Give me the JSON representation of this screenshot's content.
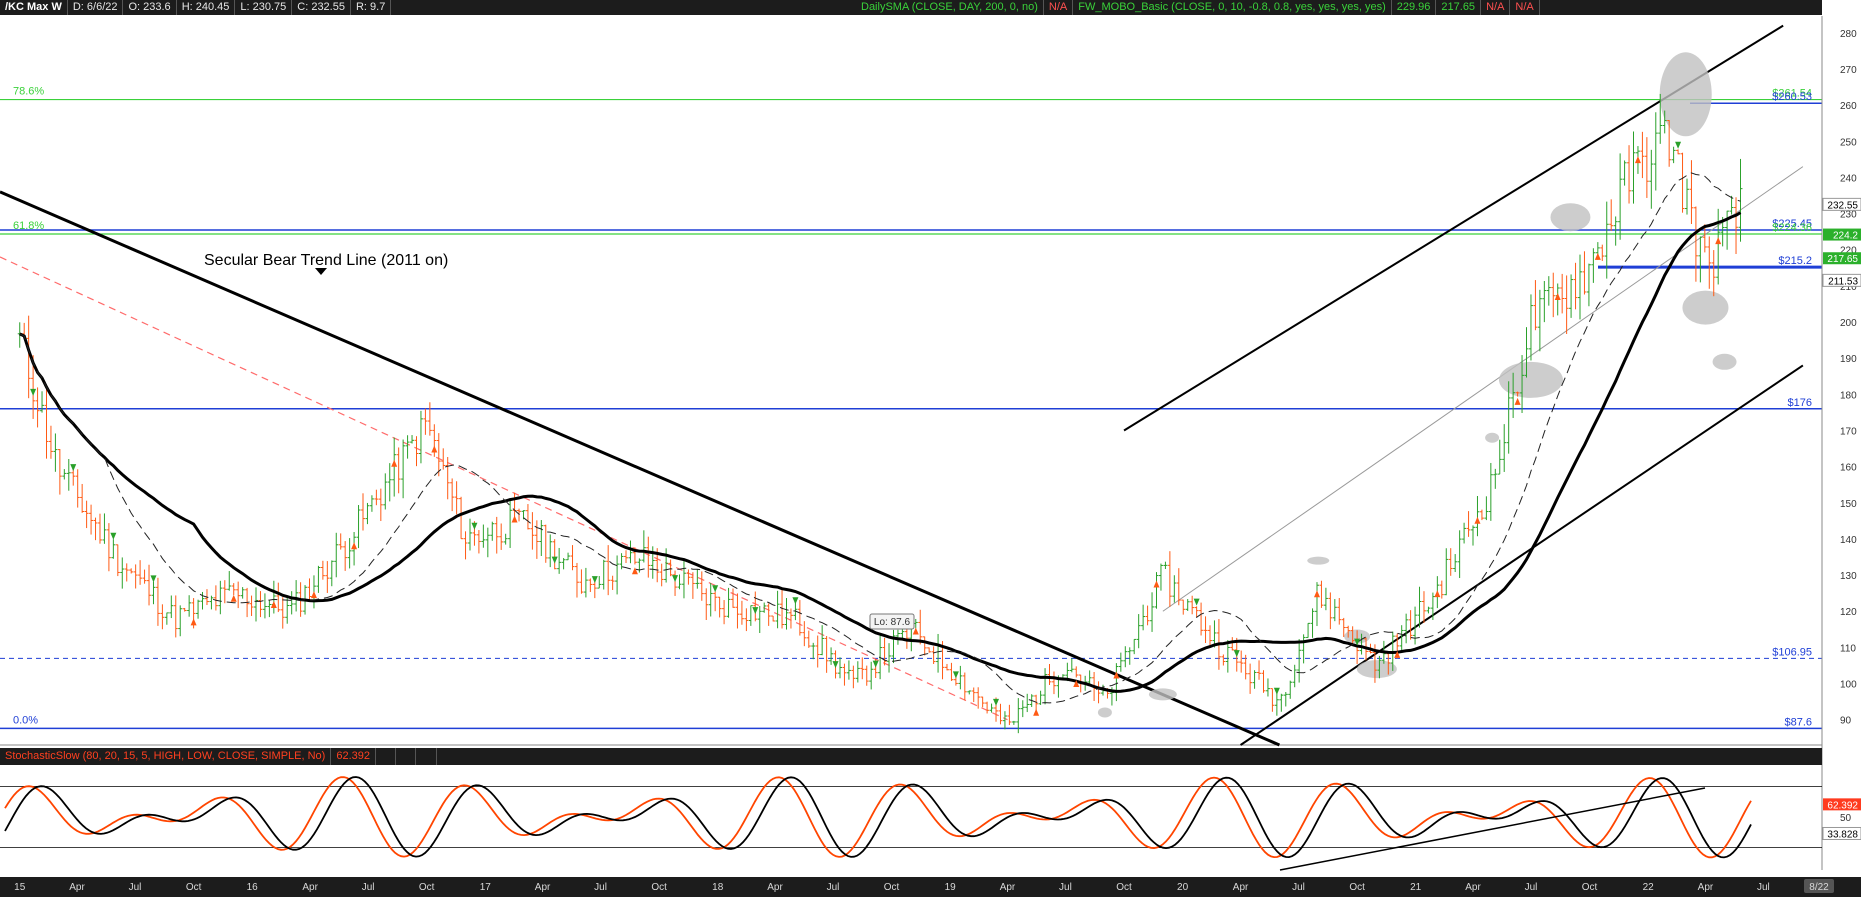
{
  "header": {
    "symbol": "/KC Max W",
    "date": "D: 6/6/22",
    "open": "O: 233.6",
    "high": "H: 240.45",
    "low": "L: 230.75",
    "close": "C: 232.55",
    "range": "R: 9.7",
    "study1": "DailySMA (CLOSE, DAY, 200, 0, no)",
    "study1_value": "N/A",
    "study2": "FW_MOBO_Basic (CLOSE, 0, 10, -0.8, 0.8, yes, yes, yes, yes)",
    "study2_v1": "229.96",
    "study2_v2": "217.65",
    "study2_v3": "N/A",
    "study2_v4": "N/A"
  },
  "lower_header": {
    "study": "StochasticSlow (80, 20, 15, 5, HIGH, LOW, CLOSE, SIMPLE, No)",
    "value": "62.392"
  },
  "colors": {
    "background": "#ffffff",
    "header_bg": "#1c1c1c",
    "up_bar": "#2aa02a",
    "down_bar": "#ff5a14",
    "bull_band": "#9ed89e",
    "bear_band": "#f29a9a",
    "support_line": "#1f3fd6",
    "fib_line": "#3ad13a",
    "stoch_k": "#ff4500",
    "stoch_d": "#000000"
  },
  "chart_data": [
    {
      "type": "candlestick",
      "title": "/KC Max W",
      "xlabel": "",
      "ylabel": "",
      "ylim": [
        83,
        283
      ],
      "x_ticks": [
        "15",
        "Apr",
        "Jul",
        "Oct",
        "16",
        "Apr",
        "Jul",
        "Oct",
        "17",
        "Apr",
        "Jul",
        "Oct",
        "18",
        "Apr",
        "Jul",
        "Oct",
        "19",
        "Apr",
        "Jul",
        "Oct",
        "20",
        "Apr",
        "Jul",
        "Oct",
        "21",
        "Apr",
        "Jul",
        "Oct",
        "22",
        "Apr",
        "Jul",
        "8/22"
      ],
      "y_ticks": [
        90,
        100,
        110,
        120,
        130,
        140,
        150,
        160,
        170,
        180,
        190,
        200,
        210,
        220,
        230,
        240,
        250,
        260,
        270,
        280
      ],
      "price_path": [
        {
          "date": "2015-01",
          "price": 195
        },
        {
          "date": "2015-03",
          "price": 160
        },
        {
          "date": "2015-06",
          "price": 135
        },
        {
          "date": "2015-09",
          "price": 118
        },
        {
          "date": "2015-12",
          "price": 125
        },
        {
          "date": "2016-03",
          "price": 120
        },
        {
          "date": "2016-06",
          "price": 140
        },
        {
          "date": "2016-10",
          "price": 172
        },
        {
          "date": "2016-12",
          "price": 140
        },
        {
          "date": "2017-03",
          "price": 145
        },
        {
          "date": "2017-06",
          "price": 128
        },
        {
          "date": "2017-09",
          "price": 135
        },
        {
          "date": "2018-01",
          "price": 122
        },
        {
          "date": "2018-05",
          "price": 118
        },
        {
          "date": "2018-08",
          "price": 100
        },
        {
          "date": "2018-11",
          "price": 115
        },
        {
          "date": "2019-04",
          "price": 88
        },
        {
          "date": "2019-07",
          "price": 106
        },
        {
          "date": "2019-09",
          "price": 95
        },
        {
          "date": "2019-12",
          "price": 130
        },
        {
          "date": "2020-03",
          "price": 110
        },
        {
          "date": "2020-06",
          "price": 95
        },
        {
          "date": "2020-08",
          "price": 125
        },
        {
          "date": "2020-11",
          "price": 105
        },
        {
          "date": "2021-02",
          "price": 125
        },
        {
          "date": "2021-05",
          "price": 155
        },
        {
          "date": "2021-07",
          "price": 200
        },
        {
          "date": "2021-10",
          "price": 215
        },
        {
          "date": "2021-12",
          "price": 240
        },
        {
          "date": "2022-02",
          "price": 252
        },
        {
          "date": "2022-04",
          "price": 215
        },
        {
          "date": "2022-06",
          "price": 232.55
        }
      ],
      "horizontal_levels": [
        {
          "price": 261.54,
          "label": "$261.54",
          "style": "fib"
        },
        {
          "price": 260.53,
          "label": "$260.53",
          "style": "resistance"
        },
        {
          "price": 225.45,
          "label": "$225.45",
          "style": "resistance"
        },
        {
          "price": 224.36,
          "label": "$224.36",
          "style": "fib"
        },
        {
          "price": 215.2,
          "label": "$215.2",
          "style": "support-bold"
        },
        {
          "price": 176,
          "label": "$176",
          "style": "support"
        },
        {
          "price": 106.95,
          "label": "$106.95",
          "style": "dashed"
        },
        {
          "price": 87.6,
          "label": "$87.6",
          "style": "support"
        }
      ],
      "fib_labels": [
        {
          "price": 261.54,
          "text": "78.6%"
        },
        {
          "price": 224.36,
          "text": "61.8%"
        },
        {
          "price": 87.6,
          "text": "0.0%"
        }
      ],
      "price_markers": [
        {
          "price": 232.55,
          "text": "232.55",
          "style": "last"
        },
        {
          "price": 224.2,
          "text": "224.2",
          "style": "green"
        },
        {
          "price": 217.65,
          "text": "217.65",
          "style": "green"
        },
        {
          "price": 211.53,
          "text": "211.53",
          "style": "last"
        }
      ],
      "annotations": [
        {
          "text": "Secular Bear Trend Line (2011 on)"
        },
        {
          "text": "Lo: 87.6"
        }
      ]
    },
    {
      "type": "line",
      "title": "StochasticSlow (80, 20, 15, 5, HIGH, LOW, CLOSE, SIMPLE, No)",
      "ylim": [
        0,
        100
      ],
      "y_ticks": [
        50
      ],
      "reference_lines": [
        80,
        20
      ],
      "series": [
        {
          "name": "SlowK",
          "last_value": 62.392
        },
        {
          "name": "SlowD",
          "last_value": 33.828
        }
      ],
      "price_markers": [
        {
          "value": 62.392,
          "text": "62.392",
          "style": "k"
        },
        {
          "value": 33.828,
          "text": "33.828",
          "style": "d"
        }
      ]
    }
  ]
}
